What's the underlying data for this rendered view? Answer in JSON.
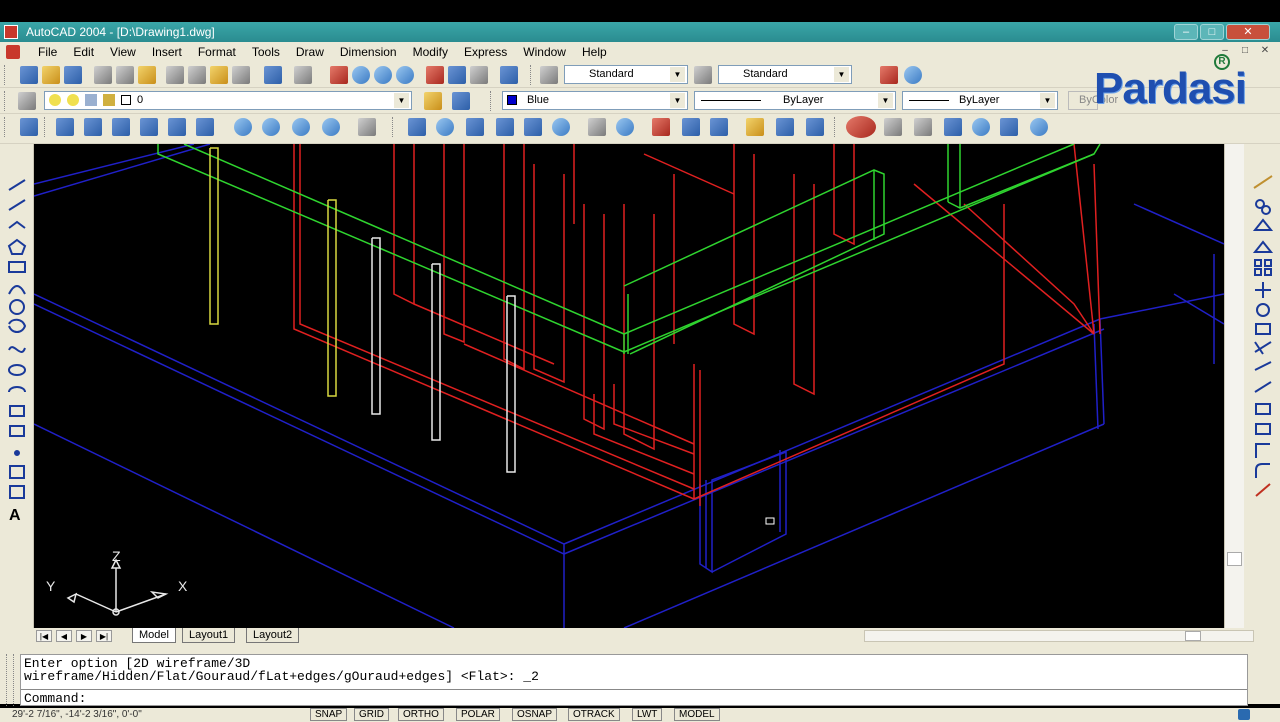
{
  "window": {
    "title": "AutoCAD 2004 - [D:\\Drawing1.dwg]",
    "controls": [
      "–",
      "□",
      "✕"
    ]
  },
  "menubar": {
    "items": [
      "File",
      "Edit",
      "View",
      "Insert",
      "Format",
      "Tools",
      "Draw",
      "Dimension",
      "Modify",
      "Express",
      "Window",
      "Help"
    ],
    "mdi_controls": [
      "–",
      "□",
      "✕"
    ]
  },
  "toolbars": {
    "text_style": "Standard",
    "dim_style": "Standard",
    "layer": "0",
    "color": "Blue",
    "linetype": "ByLayer",
    "lineweight": "ByLayer",
    "plot_style": "ByColor"
  },
  "logo": {
    "text": "Pardasi",
    "reg": "R"
  },
  "ucs": {
    "x": "X",
    "y": "Y",
    "z": "Z"
  },
  "tabs": {
    "nav": [
      "|◀",
      "◀",
      "▶",
      "▶|"
    ],
    "items": [
      "Model",
      "Layout1",
      "Layout2"
    ]
  },
  "command": {
    "history_line1": "Enter option [2D wireframe/3D",
    "history_line2": "wireframe/Hidden/Flat/Gouraud/fLat+edges/gOuraud+edges] <Flat>: _2",
    "prompt": "Command:"
  },
  "statusbar": {
    "coords": "29'-2 7/16\",  -14'-2 3/16\",  0'-0\"",
    "buttons": [
      "SNAP",
      "GRID",
      "ORTHO",
      "POLAR",
      "OSNAP",
      "OTRACK",
      "LWT",
      "MODEL"
    ]
  },
  "colors": {
    "canvas": "#000000",
    "red_walls": "#e02020",
    "green_slab": "#2fd42f",
    "blue_base": "#2020c8",
    "yellow_pipes": "#d8d840",
    "white_pipes": "#e8e8e8"
  }
}
